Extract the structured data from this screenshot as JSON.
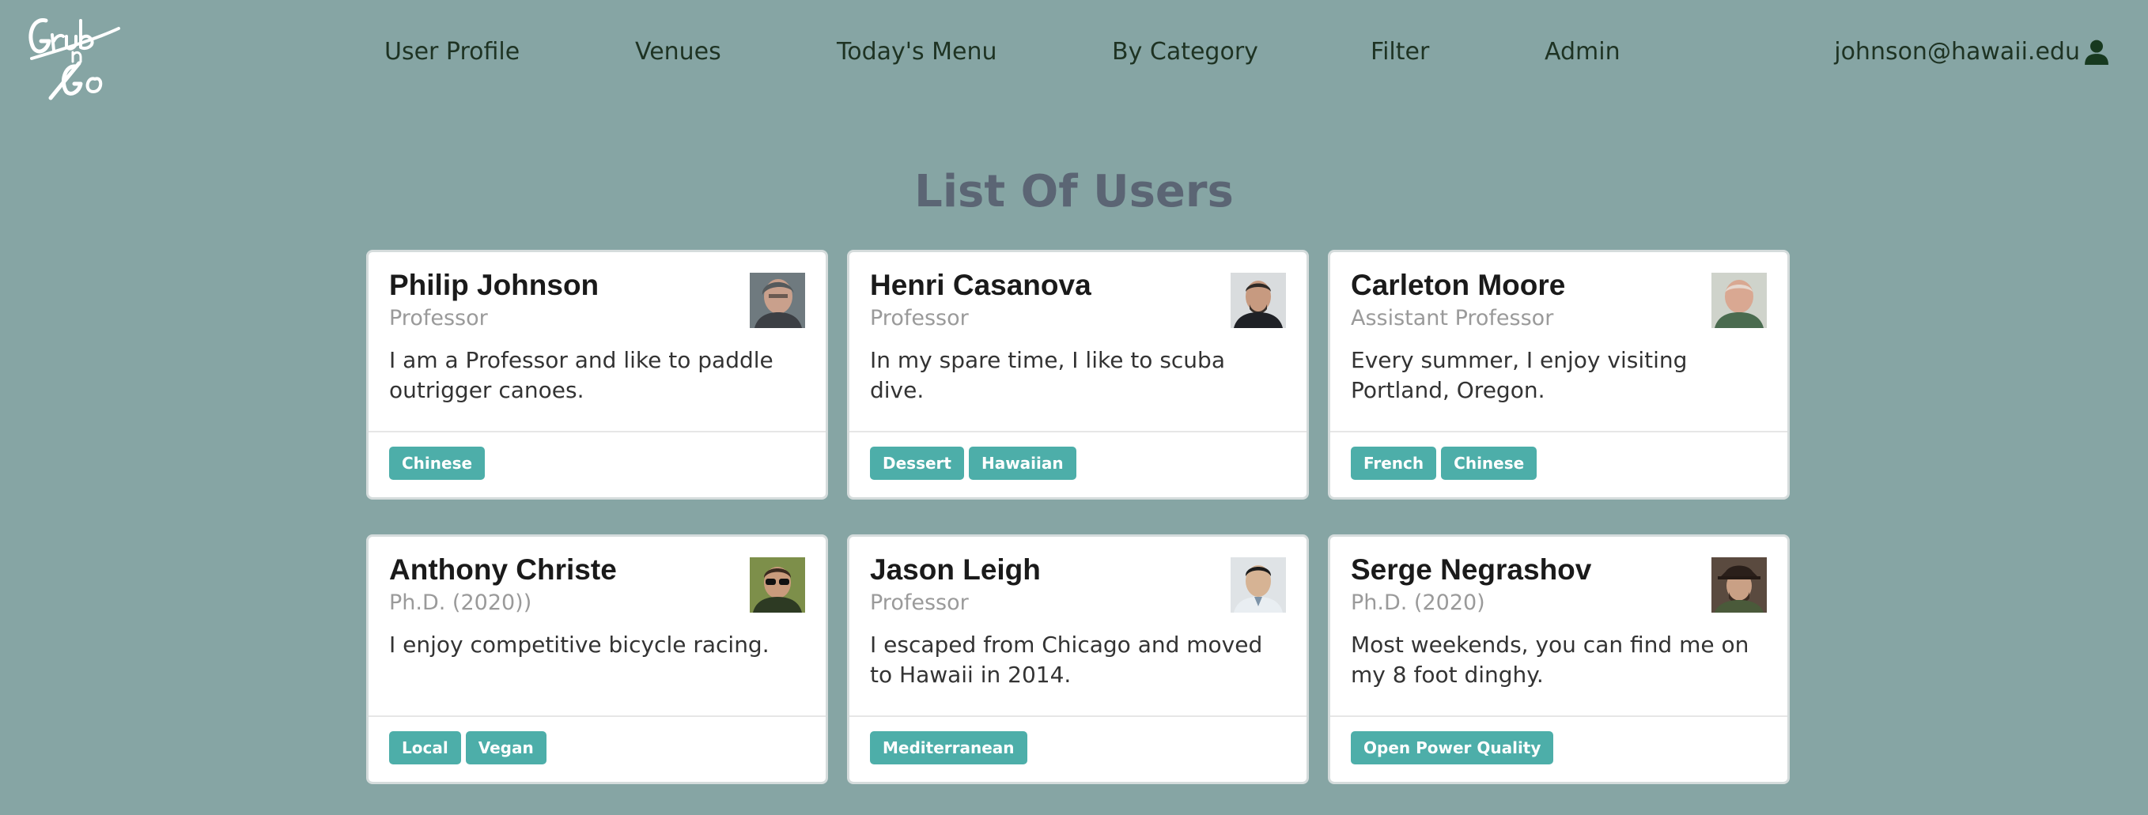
{
  "navbar": {
    "logo_text": "Grub n Go",
    "items": [
      {
        "label": "User Profile"
      },
      {
        "label": "Venues"
      },
      {
        "label": "Today's Menu"
      },
      {
        "label": "By Category"
      },
      {
        "label": "Filter"
      },
      {
        "label": "Admin"
      }
    ],
    "user": {
      "email": "johnson@hawaii.edu",
      "icon": "user-icon"
    }
  },
  "page": {
    "title": "List Of Users"
  },
  "cards": [
    {
      "name": "Philip Johnson",
      "title": "Professor",
      "description": "I am a Professor and like to paddle outrigger canoes.",
      "tags": [
        "Chinese"
      ]
    },
    {
      "name": "Henri Casanova",
      "title": "Professor",
      "description": "In my spare time, I like to scuba dive.",
      "tags": [
        "Dessert",
        "Hawaiian"
      ]
    },
    {
      "name": "Carleton Moore",
      "title": "Assistant Professor",
      "description": "Every summer, I enjoy visiting Portland, Oregon.",
      "tags": [
        "French",
        "Chinese"
      ]
    },
    {
      "name": "Anthony Christe",
      "title": "Ph.D. (2020))",
      "description": "I enjoy competitive bicycle racing.",
      "tags": [
        "Local",
        "Vegan"
      ]
    },
    {
      "name": "Jason Leigh",
      "title": "Professor",
      "description": "I escaped from Chicago and moved to Hawaii in 2014.",
      "tags": [
        "Mediterranean"
      ]
    },
    {
      "name": "Serge Negrashov",
      "title": "Ph.D. (2020)",
      "description": "Most weekends, you can find me on my 8 foot dinghy.",
      "tags": [
        "Open Power Quality"
      ]
    }
  ],
  "colors": {
    "background": "#86a5a4",
    "tag": "#4daea9",
    "title": "#5b6574",
    "nav_text": "#1e3323"
  }
}
